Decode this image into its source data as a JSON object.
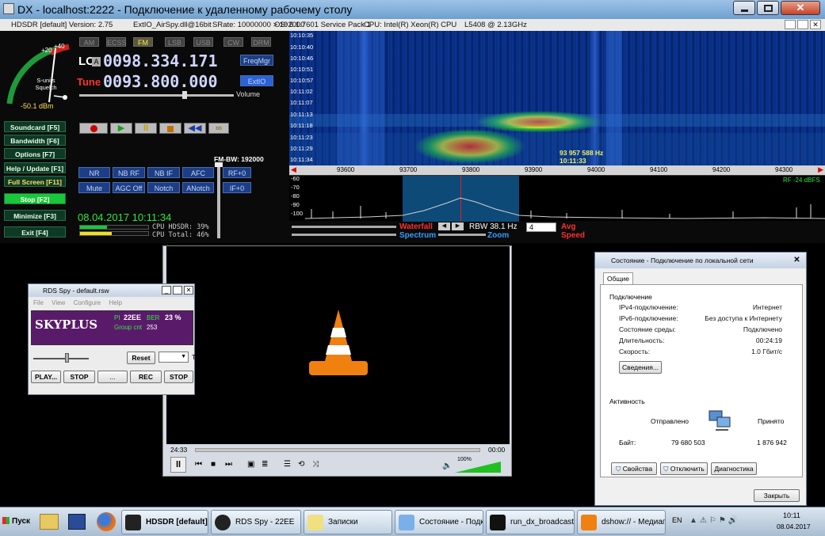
{
  "rdp": {
    "title": "DX - localhost:2222 - Подключение к удаленному рабочему столу"
  },
  "hdsdr": {
    "title_app": "HDSDR [default] Version: 2.75",
    "title_dll": "ExtIO_AirSpy.dll@16bit",
    "title_srate": "SRate: 10000000 > 192000",
    "title_os": "OS: 6.1.7601 Service Pack 1",
    "title_cpu": "CPU: Intel(R) Xeon(R) CPU",
    "title_cpu2": "L5408 @ 2.13GHz",
    "smeter_label": "S-units Squelch",
    "smeter_scale": [
      "+20",
      "+40"
    ],
    "dbm": "-50.1 dBm",
    "modes": [
      "AM",
      "ECSS",
      "FM",
      "LSB",
      "USB",
      "CW",
      "DRM"
    ],
    "lo_label": "LO",
    "lo_a": "A",
    "lo_freq": "0098.334.171",
    "tune_label": "Tune",
    "tune_freq": "0093.800.000",
    "freqmgr": "FreqMgr",
    "extio": "ExtIO",
    "volume": "Volume",
    "side_buttons": [
      "Soundcard [F5]",
      "Bandwidth [F6]",
      "Options [F7]",
      "Help / Update [F1]",
      "Full Screen [F11]",
      "Stop [F2]",
      "Minimize [F3]",
      "Exit [F4]"
    ],
    "dsp_row1": [
      "NR",
      "NB RF",
      "NB IF",
      "AFC",
      "RF+0"
    ],
    "dsp_row2": [
      "Mute",
      "AGC Off",
      "Notch",
      "ANotch",
      "IF+0"
    ],
    "fm_bw": "FM-BW: 192000",
    "datetime": "08.04.2017 10:11:34",
    "cpu_hdsdr": "CPU HDSDR: 39%",
    "cpu_total": "CPU Total: 46%",
    "wf_times": [
      "10:10:35",
      "10:10:40",
      "10:10:46",
      "10:10:51",
      "10:10:57",
      "10:11:02",
      "10:11:07",
      "10:11:13",
      "10:11:18",
      "10:11:23",
      "10:11:29",
      "10:11:34"
    ],
    "wf_marker_freq": "93 957 588 Hz",
    "wf_marker_time": "10:11:33",
    "freq_axis": [
      "93600",
      "93700",
      "93800",
      "93900",
      "94000",
      "94100",
      "94200",
      "94300"
    ],
    "spec_axis": [
      "-60",
      "-70",
      "-80",
      "-90",
      "-100"
    ],
    "rf_level": "RF -24 dBFS",
    "waterfall_label": "Waterfall",
    "spectrum_label": "Spectrum",
    "rbw": "RBW 38.1 Hz",
    "zoom_label": "Zoom",
    "avg_value": "4",
    "avg_label": "Avg",
    "speed_label": "Speed"
  },
  "rds": {
    "title": "RDS Spy - default.rsw",
    "menu": [
      "File",
      "View",
      "Configure",
      "Help"
    ],
    "ps": "SKYPLUS",
    "pi_label": "PI",
    "pi": "22EE",
    "ber_label": "BER",
    "ber": "23 %",
    "group_label": "Group cnt",
    "group": "253",
    "reset": "Reset",
    "tune": "Tune",
    "play": "PLAY...",
    "stop1": "STOP",
    "dots": "...",
    "rec": "REC",
    "stop2": "STOP"
  },
  "vlc": {
    "time_left": "24:33",
    "time_right": "00:00",
    "volume_pct": "100%"
  },
  "netdlg": {
    "title": "Состояние - Подключение по локальной сети",
    "tab": "Общие",
    "section1": "Подключение",
    "rows": [
      {
        "label": "IPv4-подключение:",
        "value": "Интернет"
      },
      {
        "label": "IPv6-подключение:",
        "value": "Без доступа к Интернету"
      },
      {
        "label": "Состояние среды:",
        "value": "Подключено"
      },
      {
        "label": "Длительность:",
        "value": "00:24:19"
      },
      {
        "label": "Скорость:",
        "value": "1.0 Гбит/с"
      }
    ],
    "details": "Сведения...",
    "section2": "Активность",
    "sent": "Отправлено",
    "received": "Принято",
    "bytes_label": "Байт:",
    "bytes_sent": "79 680 503",
    "bytes_recv": "1 876 942",
    "props": "Свойства",
    "disable": "Отключить",
    "diag": "Диагностика",
    "close": "Закрыть"
  },
  "taskbar": {
    "start": "Пуск",
    "items": [
      "HDSDR [default] ...",
      "RDS Spy - 22EE",
      "Записки",
      "Состояние - Подк...",
      "run_dx_broadcastin...",
      "dshow:// - Медиап..."
    ],
    "lang": "EN",
    "clock_time": "10:11",
    "clock_date": "08.04.2017"
  }
}
